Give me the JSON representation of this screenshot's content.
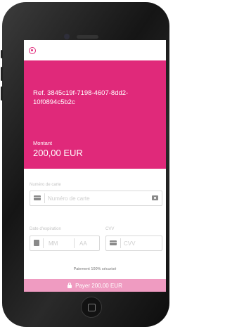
{
  "payment": {
    "reference": "Ref. 3845c19f-7198-4607-8dd2-10f0894c5b2c",
    "amount_label": "Montant",
    "amount_value": "200,00 EUR"
  },
  "card_form": {
    "card_number_label": "Numéro de carte",
    "card_number_placeholder": "Numéro de carte",
    "expiry_label": "Date d'expiration",
    "month_placeholder": "MM",
    "year_placeholder": "AA",
    "cvv_label": "CVV",
    "cvv_placeholder": "CVV"
  },
  "footer": {
    "secure_text": "Paiement 100% sécurisé",
    "pay_button_label": "Payer 200,00 EUR"
  },
  "colors": {
    "brand": "#e0297a",
    "pay_button": "#ef9bc1"
  },
  "icons": [
    "brand-logo-icon",
    "card-icon",
    "camera-scan-icon",
    "calendar-icon",
    "lock-icon",
    "home-button-icon"
  ]
}
